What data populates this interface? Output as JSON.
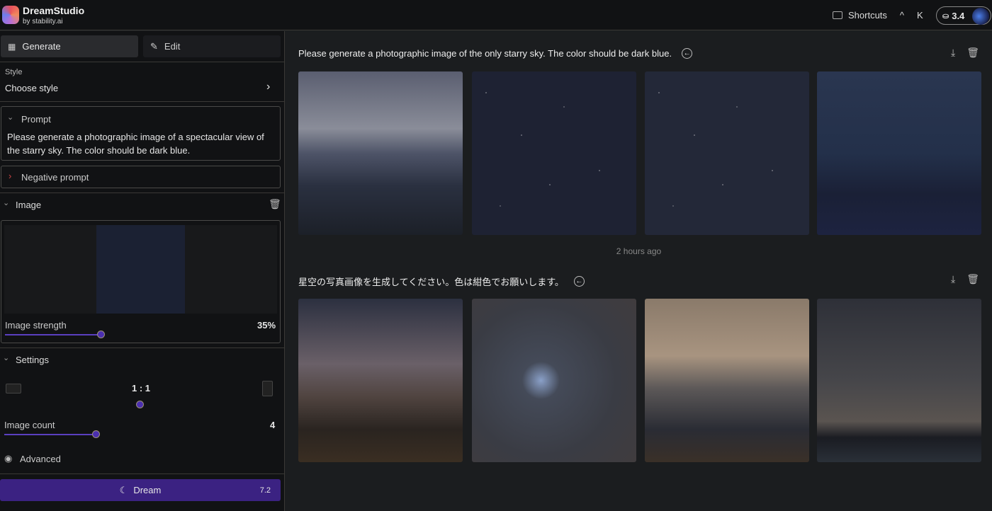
{
  "header": {
    "brand": "DreamStudio",
    "by": "by stability.ai",
    "shortcuts": "Shortcuts",
    "shortcut_keys": [
      "^",
      "K"
    ],
    "credits": "3.4"
  },
  "sidebar": {
    "tabs": [
      {
        "label": "Generate",
        "icon": "grid-icon"
      },
      {
        "label": "Edit",
        "icon": "edit-icon"
      }
    ],
    "style": {
      "label": "Style",
      "value": "Choose style"
    },
    "prompt": {
      "label": "Prompt",
      "text": "Please generate a photographic image of a spectacular view of the starry sky. The color should be dark blue."
    },
    "negative_prompt": {
      "label": "Negative prompt"
    },
    "image": {
      "label": "Image",
      "strength_label": "Image strength",
      "strength_value": "35%",
      "strength": 35
    },
    "settings": {
      "label": "Settings",
      "aspect": "1 : 1",
      "count_label": "Image count",
      "count_value": "4"
    },
    "advanced": "Advanced",
    "dream": {
      "label": "Dream",
      "cost": "7.2"
    }
  },
  "main": {
    "groups": [
      {
        "prompt": "Please generate a photographic image of the only starry sky. The color should be dark blue.",
        "time": "2 hours ago"
      },
      {
        "prompt": "星空の写真画像を生成してください。色は紺色でお願いします。"
      }
    ]
  },
  "colors": {
    "accent": "#3b2282",
    "slider": "#5a3fc0"
  }
}
